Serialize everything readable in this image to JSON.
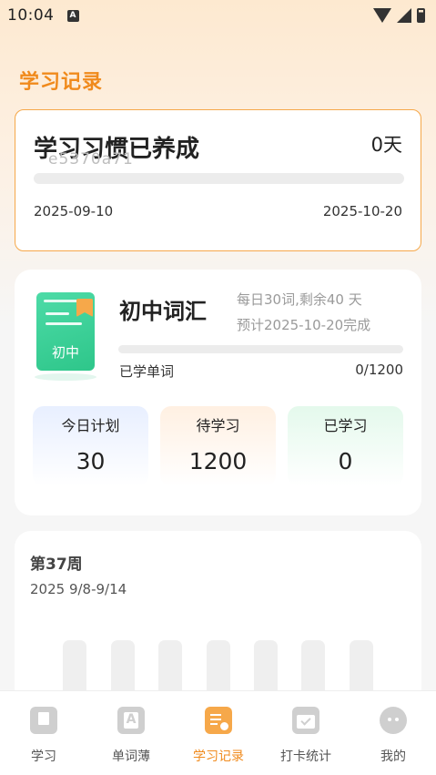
{
  "status_bar": {
    "time": "10:04",
    "notification_glyph": "A"
  },
  "page_title": "学习记录",
  "habit": {
    "title": "学习习惯已养成",
    "code": "e5370a71",
    "days": "0天",
    "progress_fraction": 0,
    "start_date": "2025-09-10",
    "end_date": "2025-10-20"
  },
  "vocab": {
    "book_label": "初中",
    "name": "初中词汇",
    "plan_text": "每日30词,剩余40 天",
    "finish_text": "预计2025-10-20完成",
    "learned_label": "已学单词",
    "learned_count": "0/1200",
    "progress_fraction": 0,
    "stats": [
      {
        "label": "今日计划",
        "value": "30"
      },
      {
        "label": "待学习",
        "value": "1200"
      },
      {
        "label": "已学习",
        "value": "0"
      }
    ]
  },
  "week": {
    "title": "第37周",
    "range": "2025 9/8-9/14"
  },
  "nav": {
    "items": [
      {
        "label": "学习",
        "icon": "book-icon"
      },
      {
        "label": "单词薄",
        "icon": "wordbook-icon"
      },
      {
        "label": "学习记录",
        "icon": "record-icon"
      },
      {
        "label": "打卡统计",
        "icon": "calendar-check-icon"
      },
      {
        "label": "我的",
        "icon": "profile-icon"
      }
    ],
    "active_index": 2
  },
  "colors": {
    "accent": "#f08a1c",
    "accent_light": "#f6a84a",
    "green": "#2ec68a",
    "inactive": "#cfcfcf"
  }
}
